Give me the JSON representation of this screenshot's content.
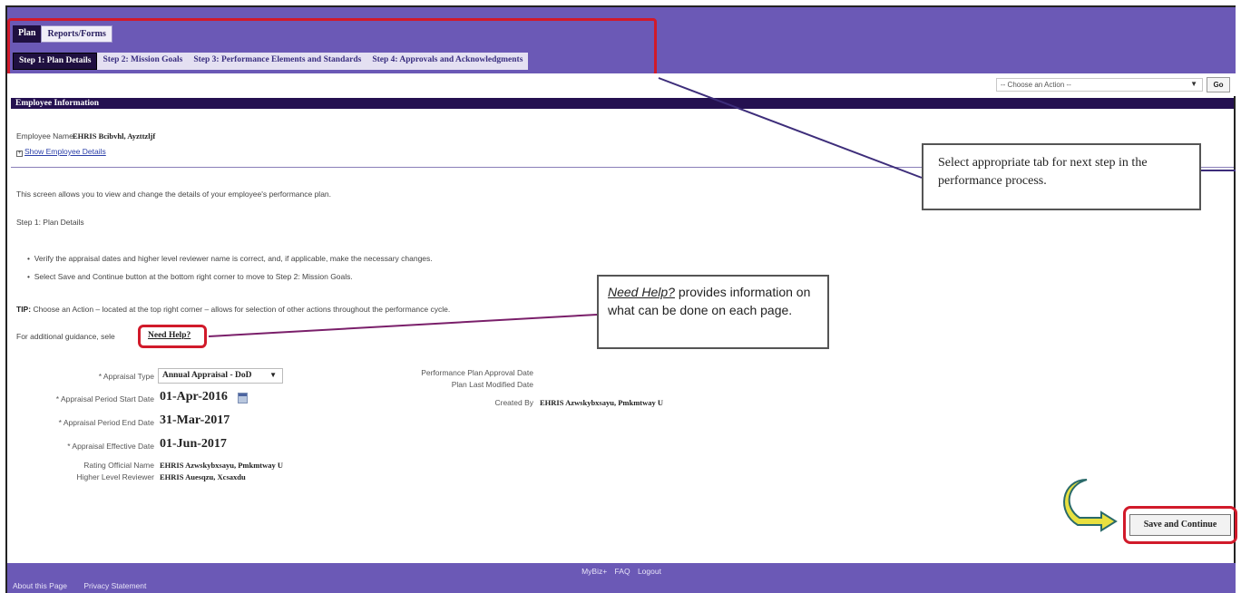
{
  "tabs": [
    {
      "label": "Plan",
      "active": true
    },
    {
      "label": "Reports/Forms",
      "active": false
    }
  ],
  "steps": [
    {
      "label": "Step 1: Plan Details",
      "active": true
    },
    {
      "label": "Step 2: Mission Goals",
      "active": false
    },
    {
      "label": "Step 3: Performance Elements and Standards",
      "active": false
    },
    {
      "label": "Step 4: Approvals and Acknowledgments",
      "active": false
    }
  ],
  "action": {
    "select_value": "-- Choose an Action --",
    "go_label": "Go"
  },
  "employee_section": {
    "title": "Employee Information",
    "name_label": "Employee Name",
    "name_value": "EHRIS Bcibvhl, Ayzttzljf",
    "show_details_label": "Show Employee Details"
  },
  "instructions": {
    "intro": "This screen allows you to view and change the details of your employee's performance plan.",
    "step_title": "Step 1: Plan Details",
    "bullet1": "Verify the appraisal dates and higher level reviewer name is correct, and, if applicable, make the necessary changes.",
    "bullet2": "Select Save and Continue button at the bottom right corner to move to Step 2: Mission Goals.",
    "tip_label": "TIP:",
    "tip_text": "Choose an Action – located at the top right corner – allows for selection of other actions throughout the performance cycle.",
    "additional": "For additional guidance, sele",
    "need_help": "Need Help?"
  },
  "form": {
    "appraisal_type_label": "* Appraisal Type",
    "appraisal_type_value": "Annual Appraisal - DoD",
    "start_date_label": "* Appraisal Period Start Date",
    "start_date_value": "01-Apr-2016",
    "end_date_label": "* Appraisal Period End Date",
    "end_date_value": "31-Mar-2017",
    "effective_date_label": "* Appraisal Effective Date",
    "effective_date_value": "01-Jun-2017",
    "rating_official_label": "Rating Official Name",
    "rating_official_value": "EHRIS Azwskybxsayu, Pmkmtway U",
    "higher_reviewer_label": "Higher Level Reviewer",
    "higher_reviewer_value": "EHRIS Auesqzu, Xcsaxdu",
    "approval_date_label": "Performance Plan Approval Date",
    "last_modified_label": "Plan Last Modified Date",
    "created_by_label": "Created By",
    "created_by_value": "EHRIS Azwskybxsayu, Pmkmtway U"
  },
  "callouts": {
    "tab_hint": "Select appropriate tab for next step in the performance process.",
    "help_hint_em": "Need Help?",
    "help_hint_rest": " provides information on what can be done on each page."
  },
  "save_button": "Save and Continue",
  "footer": {
    "center_links": [
      "MyBiz+",
      "FAQ",
      "Logout"
    ],
    "left_links": [
      "About this Page",
      "Privacy Statement"
    ]
  },
  "colors": {
    "header_purple": "#6b59b6",
    "section_dark": "#241050",
    "highlight_red": "#d11a2a",
    "arrow_yellow": "#e8e040"
  }
}
